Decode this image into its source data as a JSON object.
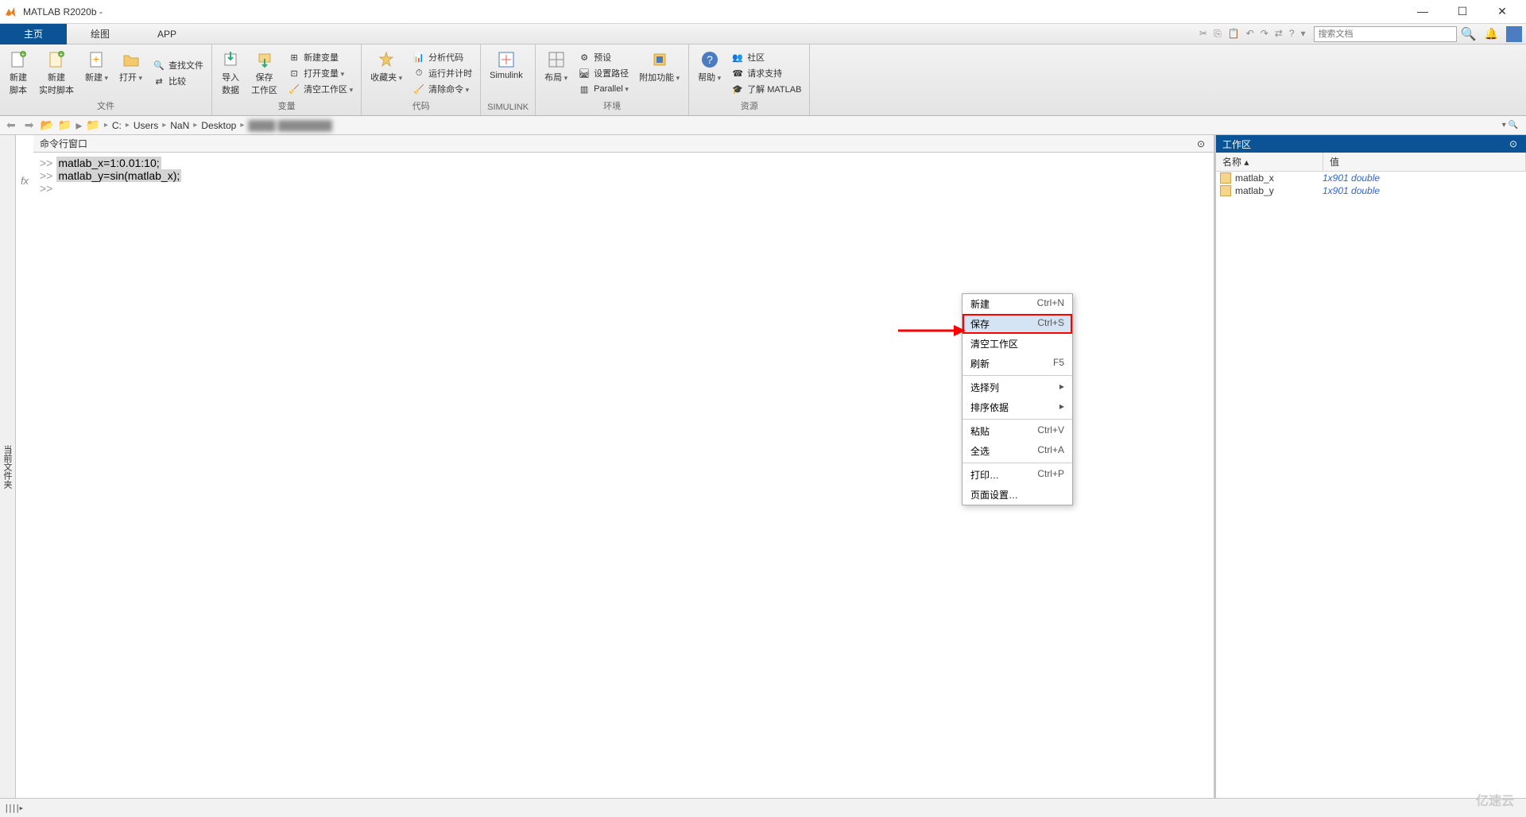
{
  "titlebar": {
    "title": "MATLAB R2020b - "
  },
  "tabs": {
    "home": "主页",
    "plots": "绘图",
    "apps": "APP"
  },
  "search": {
    "placeholder": "搜索文档"
  },
  "tools": {
    "file": {
      "newScript": "新建\n脚本",
      "newLive": "新建\n实时脚本",
      "new": "新建",
      "open": "打开",
      "findFiles": "查找文件",
      "compare": "比较",
      "label": "文件"
    },
    "var": {
      "importData": "导入\n数据",
      "saveWs": "保存\n工作区",
      "newVar": "新建变量",
      "openVar": "打开变量",
      "clearWs": "清空工作区",
      "label": "变量"
    },
    "code": {
      "fav": "收藏夹",
      "analyze": "分析代码",
      "runTime": "运行并计时",
      "clearCmd": "清除命令",
      "label": "代码"
    },
    "simulink": {
      "simulink": "Simulink",
      "label": "SIMULINK"
    },
    "env": {
      "layout": "布局",
      "prefs": "预设",
      "setPath": "设置路径",
      "parallel": "Parallel",
      "addons": "附加功能",
      "label": "环境"
    },
    "res": {
      "help": "帮助",
      "community": "社区",
      "support": "请求支持",
      "learn": "了解 MATLAB",
      "label": "资源"
    }
  },
  "breadcrumbs": [
    "C:",
    "Users",
    "NaN",
    "Desktop"
  ],
  "sidetab": "当前文件夹",
  "cmd": {
    "title": "命令行窗口",
    "lines": [
      "matlab_x=1:0.01:10;",
      "matlab_y=sin(matlab_x);"
    ],
    "prompt": ">>"
  },
  "workspace": {
    "title": "工作区",
    "cols": {
      "name": "名称 ▴",
      "value": "值"
    },
    "vars": [
      {
        "name": "matlab_x",
        "value": "1x901 double"
      },
      {
        "name": "matlab_y",
        "value": "1x901 double"
      }
    ]
  },
  "context": {
    "new": "新建",
    "newSc": "Ctrl+N",
    "save": "保存",
    "saveSc": "Ctrl+S",
    "clear": "清空工作区",
    "refresh": "刷新",
    "refreshSc": "F5",
    "selectCol": "选择列",
    "sortBy": "排序依据",
    "paste": "粘贴",
    "pasteSc": "Ctrl+V",
    "selectAll": "全选",
    "selectAllSc": "Ctrl+A",
    "print": "打印…",
    "printSc": "Ctrl+P",
    "pageSetup": "页面设置…"
  },
  "statusbar": {
    "pause": "||||▸"
  },
  "watermark": "亿速云"
}
